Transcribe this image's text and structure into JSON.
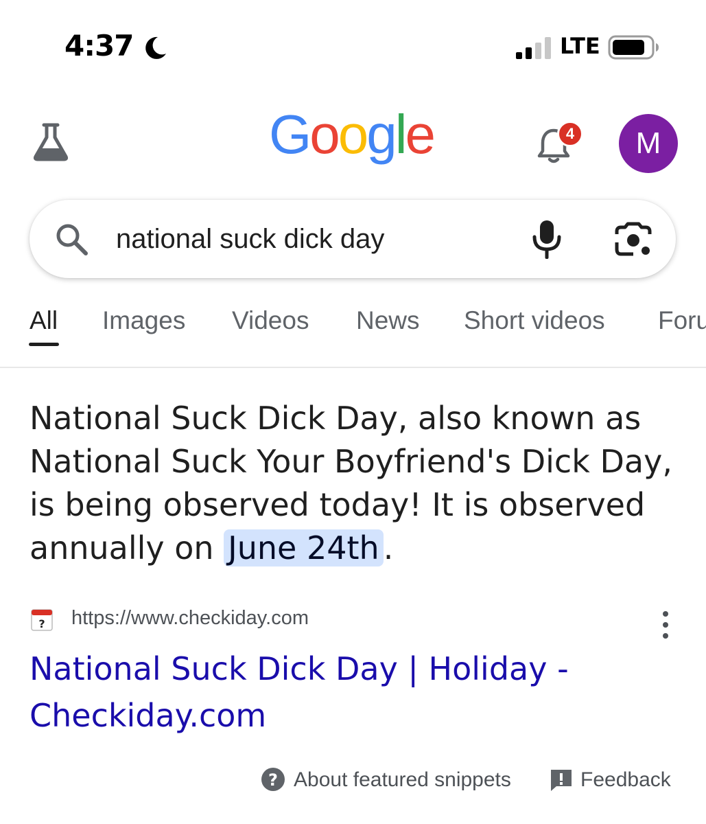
{
  "status_bar": {
    "time": "4:37",
    "network": "LTE",
    "icons": [
      "moon-icon",
      "signal-icon",
      "battery-icon"
    ]
  },
  "header": {
    "labs_icon": "flask-icon",
    "logo_letters": [
      {
        "char": "G",
        "color": "#4285f4"
      },
      {
        "char": "o",
        "color": "#ea4335"
      },
      {
        "char": "o",
        "color": "#fbbc05"
      },
      {
        "char": "g",
        "color": "#4285f4"
      },
      {
        "char": "l",
        "color": "#34a853"
      },
      {
        "char": "e",
        "color": "#ea4335"
      }
    ],
    "notification_count": "4",
    "avatar_initial": "M",
    "avatar_color": "#7b1fa2"
  },
  "search": {
    "query": "national suck dick day",
    "icons": [
      "search-icon",
      "mic-icon",
      "lens-icon"
    ]
  },
  "tabs": [
    {
      "label": "All",
      "active": true
    },
    {
      "label": "Images",
      "active": false
    },
    {
      "label": "Videos",
      "active": false
    },
    {
      "label": "News",
      "active": false
    },
    {
      "label": "Short videos",
      "active": false
    },
    {
      "label": "Foru",
      "active": false
    }
  ],
  "snippet": {
    "text": "National Suck Dick Day, also known as National Suck Your Boyfriend's Dick Day, is being observed today! It is observed annually on ",
    "highlight": "June 24th",
    "suffix": "."
  },
  "source": {
    "url": "https://www.checkiday.com",
    "title": "National Suck Dick Day | Holiday - Checkiday.com",
    "link_color": "#1a0dab"
  },
  "footer": {
    "about_label": "About featured snippets",
    "feedback_label": "Feedback"
  }
}
